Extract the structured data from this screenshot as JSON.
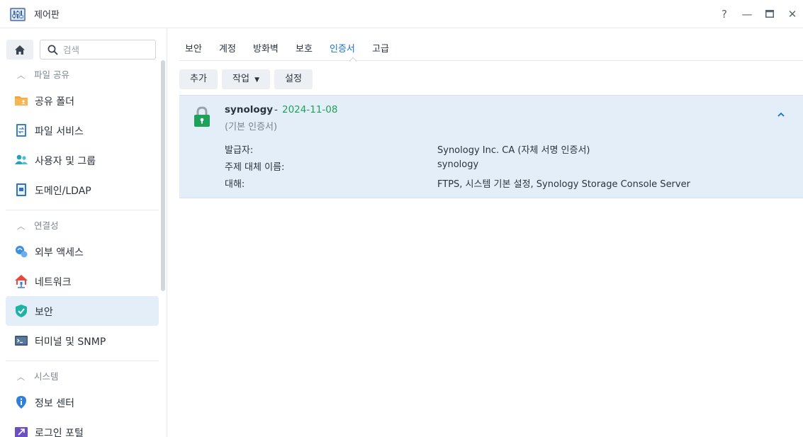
{
  "window": {
    "title": "제어판",
    "controls": {
      "help": "?",
      "minimize": "—",
      "maximize": "▭",
      "close": "✕"
    }
  },
  "sidebar": {
    "search_placeholder": "검색",
    "sections": [
      {
        "header": "파일 공유",
        "items": [
          "공유 폴더",
          "파일 서비스",
          "사용자 및 그룹",
          "도메인/LDAP"
        ]
      },
      {
        "header": "연결성",
        "items": [
          "외부 액세스",
          "네트워크",
          "보안",
          "터미널 및 SNMP"
        ]
      },
      {
        "header": "시스템",
        "items": [
          "정보 센터",
          "로그인 포털"
        ]
      }
    ],
    "active_item": "보안"
  },
  "tabs": [
    "보안",
    "계정",
    "방화벽",
    "보호",
    "인증서",
    "고급"
  ],
  "active_tab": "인증서",
  "toolbar": {
    "add": "추가",
    "action": "작업",
    "settings": "설정"
  },
  "certificate": {
    "name": "synology",
    "separator": "-",
    "date": "2024-11-08",
    "subtitle": "(기본 인증서)",
    "details": [
      {
        "label": "발급자:",
        "value": "Synology Inc. CA (자체 서명 인증서)"
      },
      {
        "label": "주제 대체 이름:",
        "value": "synology"
      },
      {
        "label": "대해:",
        "value": "FTPS, 시스템 기본 설정, Synology Storage Console Server"
      }
    ]
  },
  "colors": {
    "accent": "#1a73c9",
    "active_bg": "#e4eef9",
    "date_green": "#1ea25a",
    "lock_green": "#1ea25a"
  }
}
